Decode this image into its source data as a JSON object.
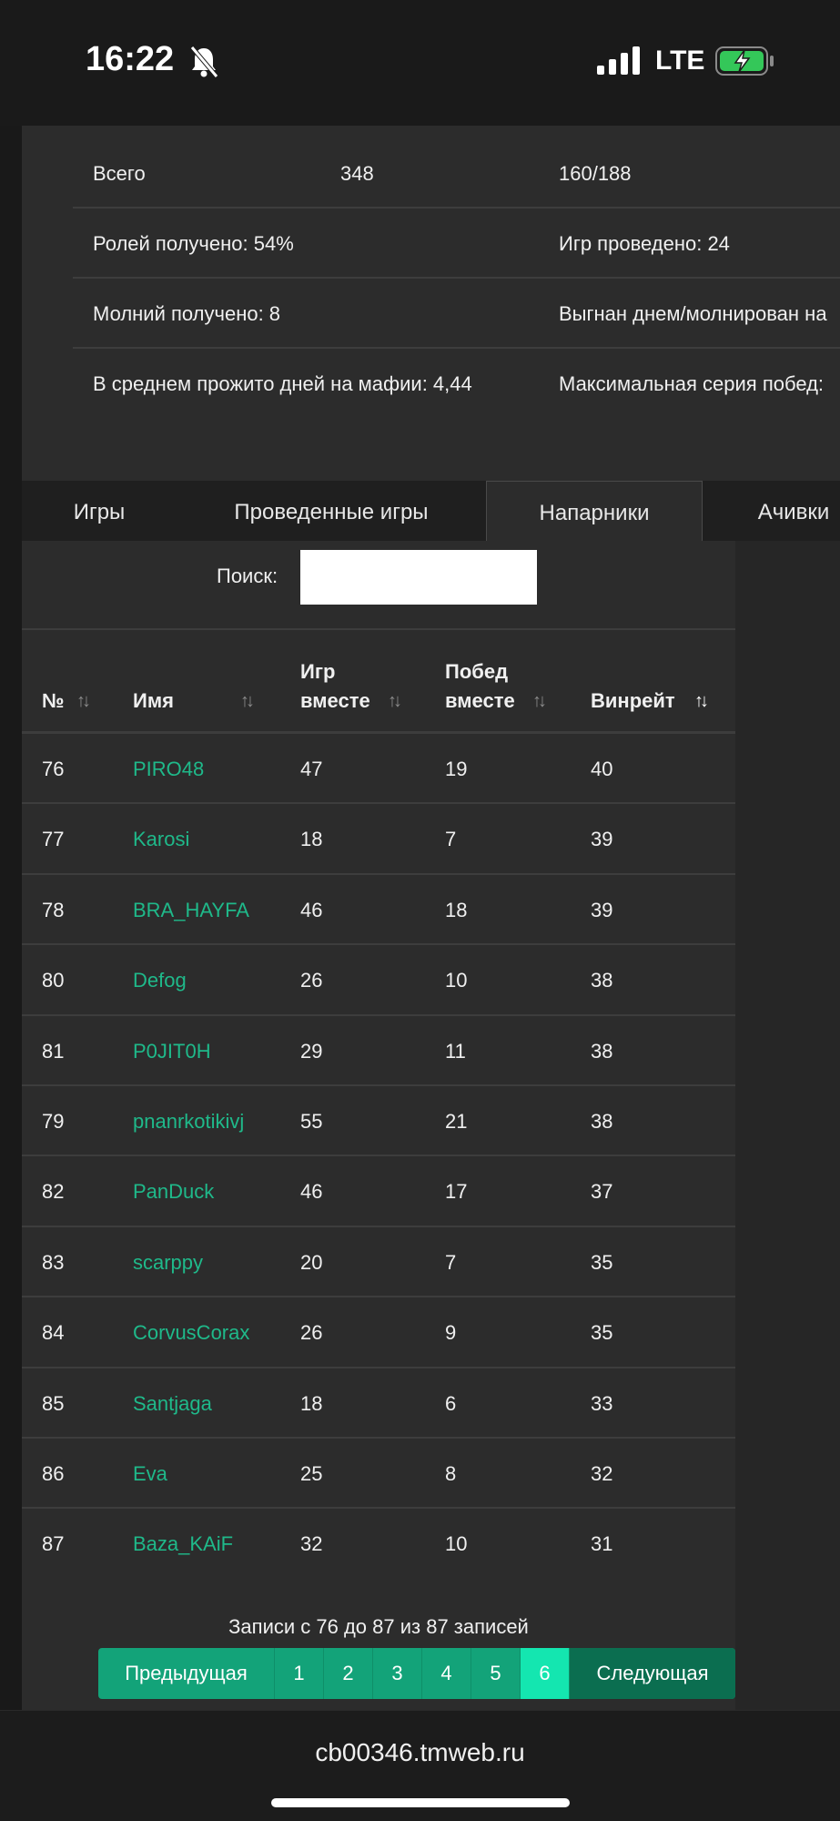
{
  "status_bar": {
    "time": "16:22",
    "network": "LTE"
  },
  "stats": {
    "rows": [
      {
        "c1": "Всего",
        "c2": "348",
        "c3": "160/188"
      },
      {
        "c1": "Ролей получено: 54%",
        "c2": "",
        "c3": "Игр проведено: 24"
      },
      {
        "c1": "Молний получено: 8",
        "c2": "",
        "c3": "Выгнан днем/молнирован на"
      },
      {
        "c1": "В среднем прожито дней на мафии: 4,44",
        "c2": "",
        "c3": "Максимальная серия побед:"
      }
    ]
  },
  "tabs": [
    "Игры",
    "Проведенные игры",
    "Напарники",
    "Ачивки"
  ],
  "search": {
    "label": "Поиск:",
    "value": ""
  },
  "table": {
    "headers": {
      "num": "№",
      "name": "Имя",
      "games_l1": "Игр",
      "games_l2": "вместе",
      "wins_l1": "Побед",
      "wins_l2": "вместе",
      "winrate": "Винрейт"
    },
    "rows": [
      {
        "num": "76",
        "name": "PIRO48",
        "games": "47",
        "wins": "19",
        "winrate": "40"
      },
      {
        "num": "77",
        "name": "Karosi",
        "games": "18",
        "wins": "7",
        "winrate": "39"
      },
      {
        "num": "78",
        "name": "BRA_HAYFA",
        "games": "46",
        "wins": "18",
        "winrate": "39"
      },
      {
        "num": "80",
        "name": "Defog",
        "games": "26",
        "wins": "10",
        "winrate": "38"
      },
      {
        "num": "81",
        "name": "P0JIT0H",
        "games": "29",
        "wins": "11",
        "winrate": "38"
      },
      {
        "num": "79",
        "name": "pnanrkotikivj",
        "games": "55",
        "wins": "21",
        "winrate": "38"
      },
      {
        "num": "82",
        "name": "PanDuck",
        "games": "46",
        "wins": "17",
        "winrate": "37"
      },
      {
        "num": "83",
        "name": "scarppy",
        "games": "20",
        "wins": "7",
        "winrate": "35"
      },
      {
        "num": "84",
        "name": "CorvusCorax",
        "games": "26",
        "wins": "9",
        "winrate": "35"
      },
      {
        "num": "85",
        "name": "Santjaga",
        "games": "18",
        "wins": "6",
        "winrate": "33"
      },
      {
        "num": "86",
        "name": "Eva",
        "games": "25",
        "wins": "8",
        "winrate": "32"
      },
      {
        "num": "87",
        "name": "Baza_KAiF",
        "games": "32",
        "wins": "10",
        "winrate": "31"
      }
    ]
  },
  "info": "Записи с 76 до 87 из 87 записей",
  "pagination": {
    "prev": "Предыдущая",
    "pages": [
      "1",
      "2",
      "3",
      "4",
      "5",
      "6"
    ],
    "next": "Следующая"
  },
  "url": "cb00346.tmweb.ru"
}
